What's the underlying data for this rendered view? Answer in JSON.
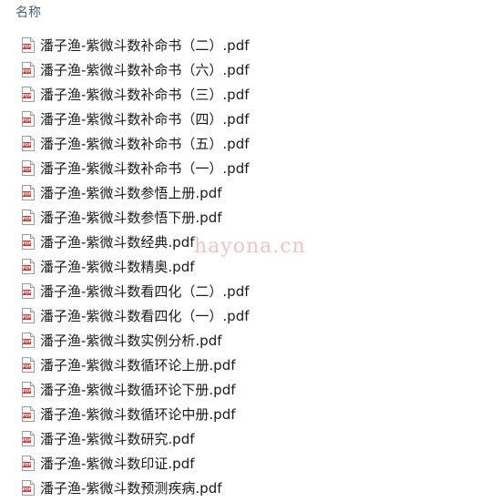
{
  "header": {
    "sort_caret": "^",
    "name_column": "名称"
  },
  "files": [
    {
      "name": "潘子渔-紫微斗数补命书（二）.pdf",
      "icon": "pdf-file-icon"
    },
    {
      "name": "潘子渔-紫微斗数补命书（六）.pdf",
      "icon": "pdf-file-icon"
    },
    {
      "name": "潘子渔-紫微斗数补命书（三）.pdf",
      "icon": "pdf-file-icon"
    },
    {
      "name": "潘子渔-紫微斗数补命书（四）.pdf",
      "icon": "pdf-file-icon"
    },
    {
      "name": "潘子渔-紫微斗数补命书（五）.pdf",
      "icon": "pdf-file-icon"
    },
    {
      "name": "潘子渔-紫微斗数补命书（一）.pdf",
      "icon": "pdf-file-icon"
    },
    {
      "name": "潘子渔-紫微斗数参悟上册.pdf",
      "icon": "pdf-file-icon"
    },
    {
      "name": "潘子渔-紫微斗数参悟下册.pdf",
      "icon": "pdf-file-icon"
    },
    {
      "name": "潘子渔-紫微斗数经典.pdf",
      "icon": "pdf-file-icon"
    },
    {
      "name": "潘子渔-紫微斗数精奥.pdf",
      "icon": "pdf-file-icon"
    },
    {
      "name": "潘子渔-紫微斗数看四化（二）.pdf",
      "icon": "pdf-file-icon"
    },
    {
      "name": "潘子渔-紫微斗数看四化（一）.pdf",
      "icon": "pdf-file-icon"
    },
    {
      "name": "潘子渔-紫微斗数实例分析.pdf",
      "icon": "pdf-file-icon"
    },
    {
      "name": "潘子渔-紫微斗数循环论上册.pdf",
      "icon": "pdf-file-icon"
    },
    {
      "name": "潘子渔-紫微斗数循环论下册.pdf",
      "icon": "pdf-file-icon"
    },
    {
      "name": "潘子渔-紫微斗数循环论中册.pdf",
      "icon": "pdf-file-icon"
    },
    {
      "name": "潘子渔-紫微斗数研究.pdf",
      "icon": "pdf-file-icon"
    },
    {
      "name": "潘子渔-紫微斗数印证.pdf",
      "icon": "pdf-file-icon"
    },
    {
      "name": "潘子渔-紫微斗数预测疾病.pdf",
      "icon": "pdf-file-icon"
    }
  ],
  "watermark": "hayona.cn",
  "colors": {
    "header_text": "#4c607a",
    "pdf_red": "#d93025",
    "watermark": "#e67878"
  }
}
